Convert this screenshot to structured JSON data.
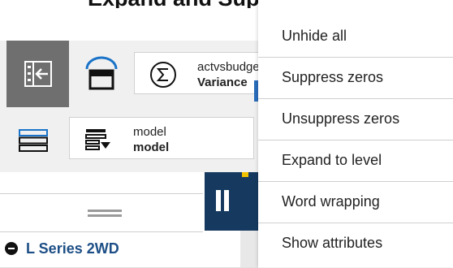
{
  "header": {
    "clipped_title": "Expand and Support"
  },
  "toolbar": {
    "data_source_line1": "actvsbudget",
    "data_source_line2": "Variance",
    "model_line1": "model",
    "model_line2": "model"
  },
  "grid": {
    "row_label": "L Series 2WD"
  },
  "context_menu": {
    "items": [
      {
        "label": "Unhide all"
      },
      {
        "label": "Suppress zeros"
      },
      {
        "label": "Unsuppress zeros"
      },
      {
        "label": "Expand to level"
      },
      {
        "label": "Word wrapping"
      },
      {
        "label": "Show attributes"
      }
    ]
  },
  "colors": {
    "panel_bg": "#f0f0f0",
    "collapse_bg": "#6f6f6f",
    "dark_tile": "#163a5f",
    "accent_blue": "#2a6ebd",
    "row_label": "#1d4f86",
    "gold": "#f2c200"
  }
}
